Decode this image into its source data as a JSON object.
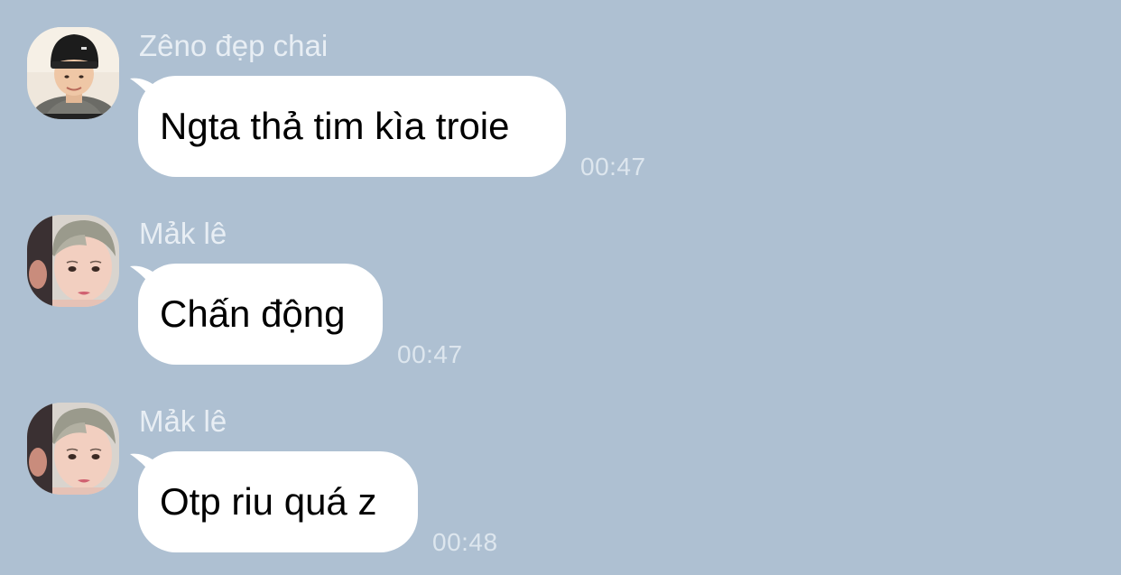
{
  "colors": {
    "background": "#aec0d2",
    "bubble": "#ffffff",
    "sender_name": "#e8eef4",
    "timestamp": "#dde6ee"
  },
  "messages": [
    {
      "sender": "Zêno đẹp chai",
      "avatar": "avatar-person-beanie",
      "text": "Ngta thả tim kìa troie",
      "time": "00:47"
    },
    {
      "sender": "Mảk lê",
      "avatar": "avatar-person-blonde",
      "text": "Chấn động",
      "time": "00:47"
    },
    {
      "sender": "Mảk lê",
      "avatar": "avatar-person-blonde",
      "text": "Otp riu quá z",
      "time": "00:48"
    }
  ]
}
